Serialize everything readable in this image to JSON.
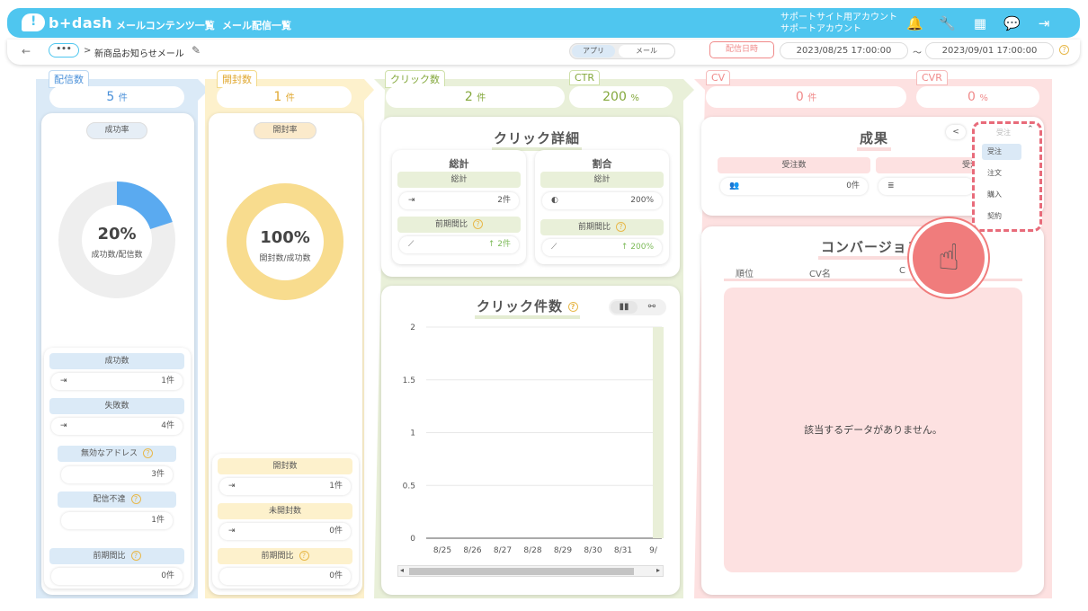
{
  "app": {
    "name": "b+dash",
    "nav": [
      "メールコンテンツ一覧",
      "メール配信一覧"
    ],
    "account_line1": "サポートサイト用アカウント",
    "account_line2": "サポートアカウント"
  },
  "breadcrumb": {
    "more": "•••",
    "separator": ">",
    "title": "新商品お知らせメール"
  },
  "toggle": {
    "app": "アプリ",
    "mail": "メール"
  },
  "date_filter": {
    "label": "配信日時",
    "start": "2023/08/25 17:00:00",
    "tilde": "〜",
    "end": "2023/09/01 17:00:00"
  },
  "delivered": {
    "header": "配信数",
    "count": "5",
    "unit": "件",
    "rate_label": "成功率",
    "donut_percent": "20%",
    "donut_caption": "成功数/配信数",
    "success_label": "成功数",
    "success_value": "1件",
    "fail_label": "失敗数",
    "fail_value": "4件",
    "invalid_label": "無効なアドレス",
    "invalid_value": "3件",
    "undelivered_label": "配信不達",
    "undelivered_value": "1件",
    "prev_label": "前期間比",
    "prev_value": "0件",
    "success_fraction": 0.2
  },
  "opened": {
    "header": "開封数",
    "count": "1",
    "unit": "件",
    "rate_label": "開封率",
    "donut_percent": "100%",
    "donut_caption": "開封数/成功数",
    "open_label": "開封数",
    "open_value": "1件",
    "unopened_label": "未開封数",
    "unopened_value": "0件",
    "prev_label": "前期間比",
    "prev_value": "0件",
    "open_fraction": 1.0
  },
  "clicks": {
    "header": "クリック数",
    "count": "2",
    "unit": "件",
    "ctr_header": "CTR",
    "ctr_value": "200",
    "ctr_unit": "%",
    "detail_title": "クリック詳細",
    "total_title": "総計",
    "ratio_title": "割合",
    "sub_total": "総計",
    "total_value": "2件",
    "ratio_value": "200%",
    "prev_label": "前期間比",
    "prev_total": "↑ 2件",
    "prev_ratio": "↑ 200%",
    "chart_title": "クリック件数"
  },
  "cv": {
    "header": "CV",
    "count": "0",
    "unit": "件",
    "cvr_header": "CVR",
    "cvr_value": "0",
    "cvr_unit": "%",
    "results_title": "成果",
    "order_count_label": "受注数",
    "order_count_value": "0件",
    "order_amount_label": "受注金額",
    "conversion_title": "コンバージョン",
    "col_rank": "順位",
    "col_name": "CV名",
    "col_c": "C",
    "empty_text": "該当するデータがありません。",
    "dropdown_selected": "受注",
    "dropdown_items": [
      "受注",
      "注文",
      "購入",
      "契約"
    ]
  },
  "colors": {
    "blue": "#4fc6ef",
    "delivered": "#dbeaf7",
    "opened": "#fdf1cc",
    "clicks": "#e9f0d9",
    "cv": "#fde1e1",
    "donut_blue": "#5aaaf0",
    "donut_yellow": "#f8dc8e"
  },
  "chart_data": {
    "type": "bar",
    "categories": [
      "8/25",
      "8/26",
      "8/27",
      "8/28",
      "8/29",
      "8/30",
      "8/31",
      "9/"
    ],
    "values": [
      0,
      0,
      0,
      0,
      0,
      0,
      0,
      0
    ],
    "ylim": [
      0,
      2
    ],
    "yticks": [
      "0",
      "0.5",
      "1",
      "1.5",
      "2"
    ],
    "title": "",
    "xlabel": "",
    "ylabel": "",
    "grid": true,
    "legend": "none"
  }
}
